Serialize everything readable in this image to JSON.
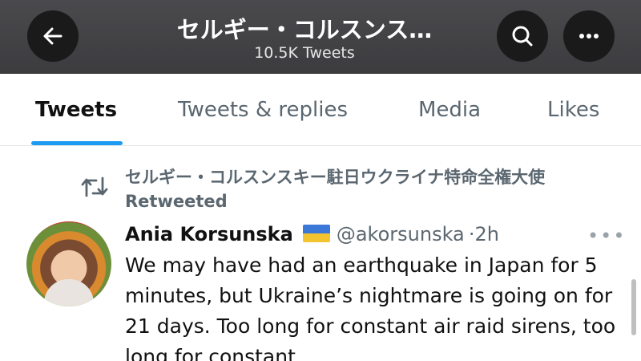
{
  "header": {
    "title": "セルギー・コルスンス…",
    "subtitle": "10.5K Tweets",
    "back_icon": "arrow-left-icon",
    "search_icon": "search-icon",
    "more_icon": "more-horizontal-icon"
  },
  "tabs": [
    {
      "label": "Tweets",
      "active": true
    },
    {
      "label": "Tweets & replies",
      "active": false
    },
    {
      "label": "Media",
      "active": false
    },
    {
      "label": "Likes",
      "active": false
    }
  ],
  "tweet": {
    "retweet_text": "セルギー・コルスンスキー駐日ウクライナ特命全権大使 Retweeted",
    "author_name": "Ania Korsunska",
    "handle": "@akorsunska",
    "separator": "·",
    "time": "2h",
    "more": "•••",
    "body": "We may have had an earthquake in Japan for 5 minutes, but Ukraine’s nightmare is going on for 21 days. Too long for constant air raid sirens, too long for constant"
  },
  "colors": {
    "header_bg": "#434346",
    "accent": "#1d9bf0",
    "secondary_text": "#5b6770",
    "flag_blue": "#3c78d8",
    "flag_yellow": "#f4c430"
  }
}
